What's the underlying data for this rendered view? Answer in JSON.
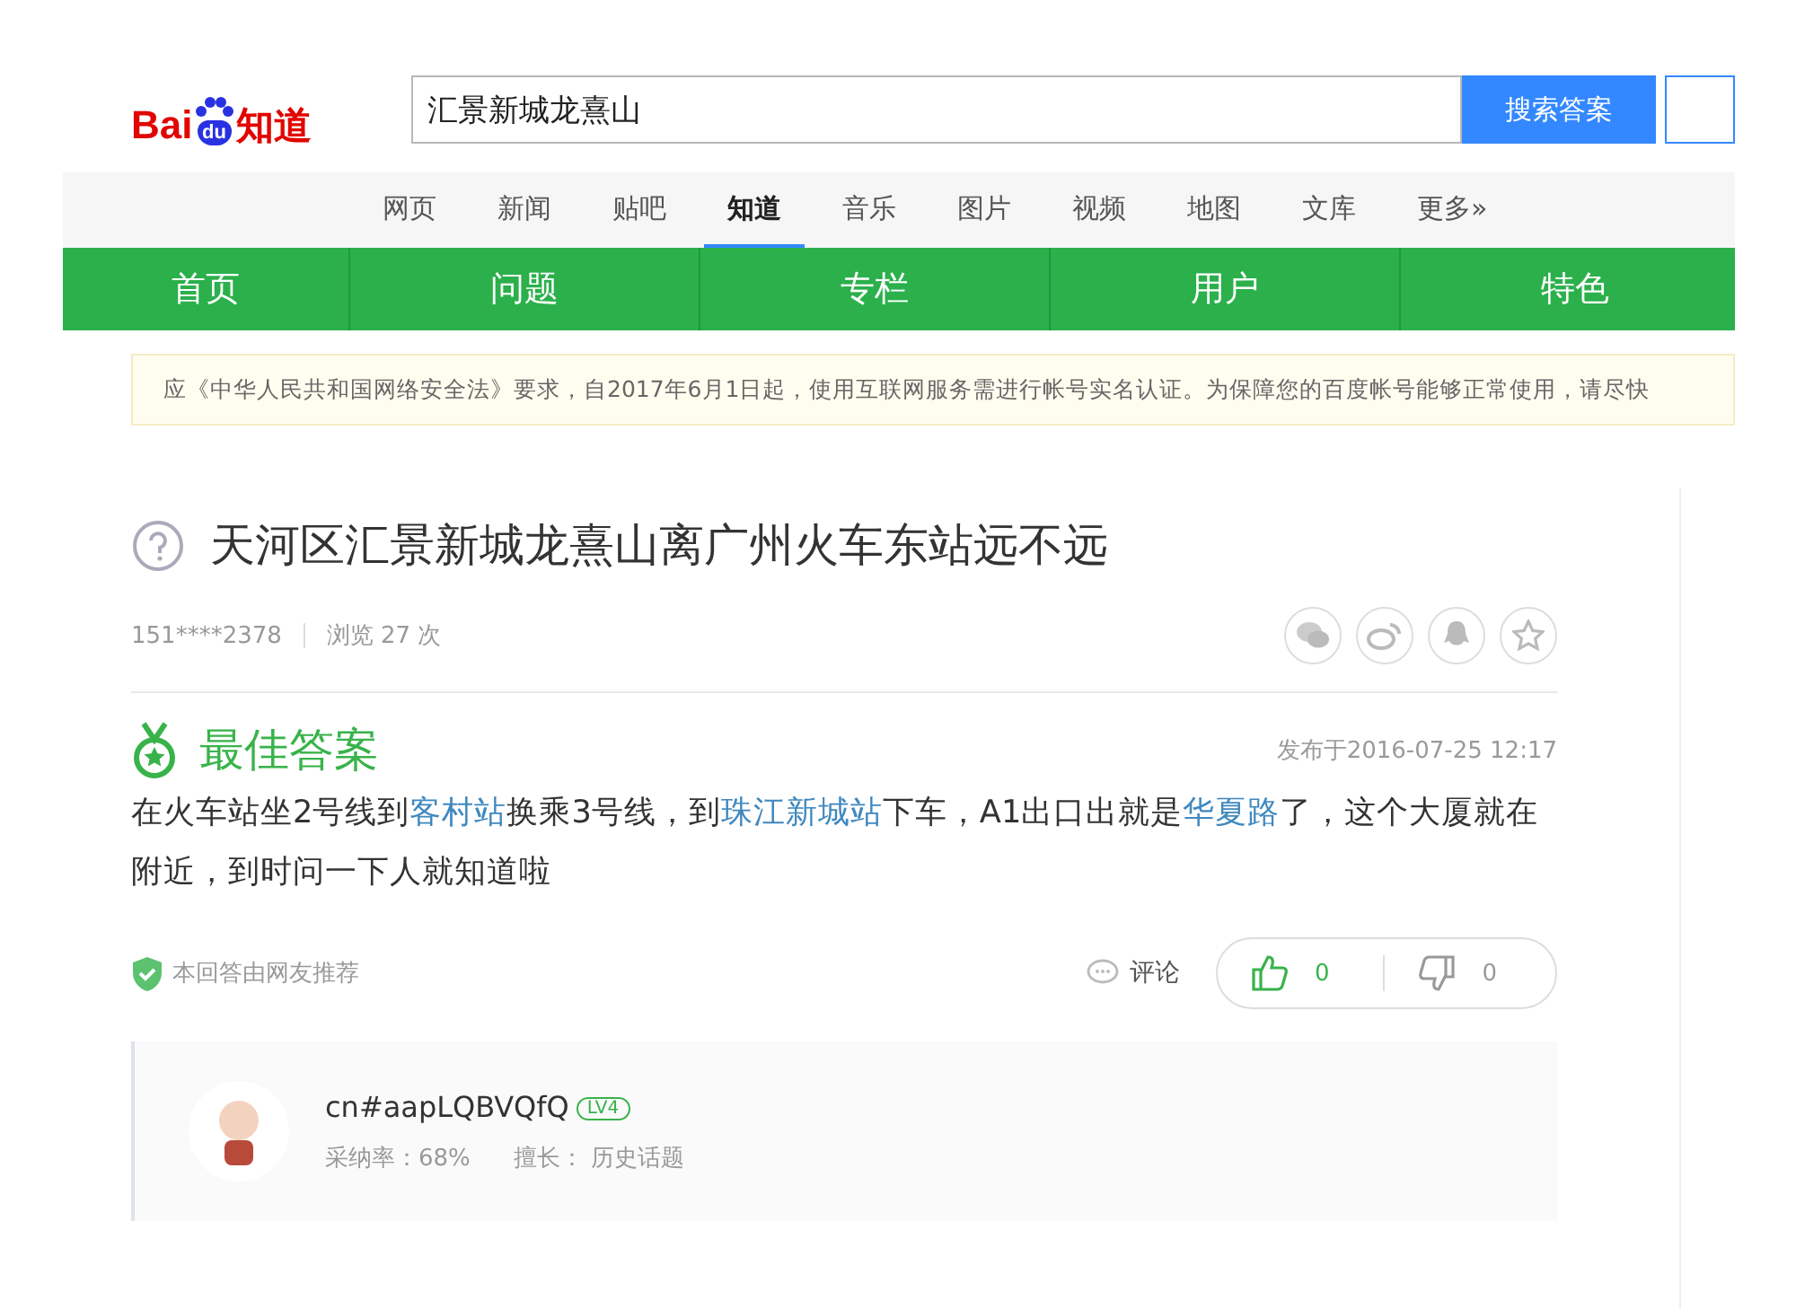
{
  "header": {
    "logo": {
      "latin": "Bai",
      "badge": "du",
      "cjk": "知道"
    },
    "search": {
      "value": "汇景新城龙熹山"
    },
    "search_button": "搜索答案"
  },
  "nav": [
    {
      "label": "网页",
      "selected": false
    },
    {
      "label": "新闻",
      "selected": false
    },
    {
      "label": "贴吧",
      "selected": false
    },
    {
      "label": "知道",
      "selected": true
    },
    {
      "label": "音乐",
      "selected": false
    },
    {
      "label": "图片",
      "selected": false
    },
    {
      "label": "视频",
      "selected": false
    },
    {
      "label": "地图",
      "selected": false
    },
    {
      "label": "文库",
      "selected": false
    },
    {
      "label": "更多»",
      "selected": false
    }
  ],
  "green_menu": [
    "首页",
    "问题",
    "专栏",
    "用户",
    "特色"
  ],
  "notice": "应《中华人民共和国网络安全法》要求，自2017年6月1日起，使用互联网服务需进行帐号实名认证。为保障您的百度帐号能够正常使用，请尽快",
  "question": {
    "title": "天河区汇景新城龙熹山离广州火车东站远不远",
    "asker": "151****2378",
    "views": "浏览 27 次"
  },
  "best_answer": {
    "heading": "最佳答案",
    "date": "发布于2016-07-25 12:17",
    "segments": [
      {
        "text": "在火车站坐2号线到",
        "link": false
      },
      {
        "text": "客村站",
        "link": true
      },
      {
        "text": "换乘3号线，到",
        "link": false
      },
      {
        "text": "珠江新城站",
        "link": true
      },
      {
        "text": "下车，A1出口出就是",
        "link": false
      },
      {
        "text": "华夏路",
        "link": true
      },
      {
        "text": "了，这个大厦就在附近，到时问一下人就知道啦",
        "link": false
      }
    ],
    "recommended": "本回答由网友推荐",
    "comment": "评论",
    "likes": "0",
    "dislikes": "0"
  },
  "answerer": {
    "name": "cn#aapLQBVQfQ",
    "level": "LV4",
    "adoption": "采纳率：68%",
    "specialty_label": "擅长：",
    "specialty": "历史话题"
  }
}
